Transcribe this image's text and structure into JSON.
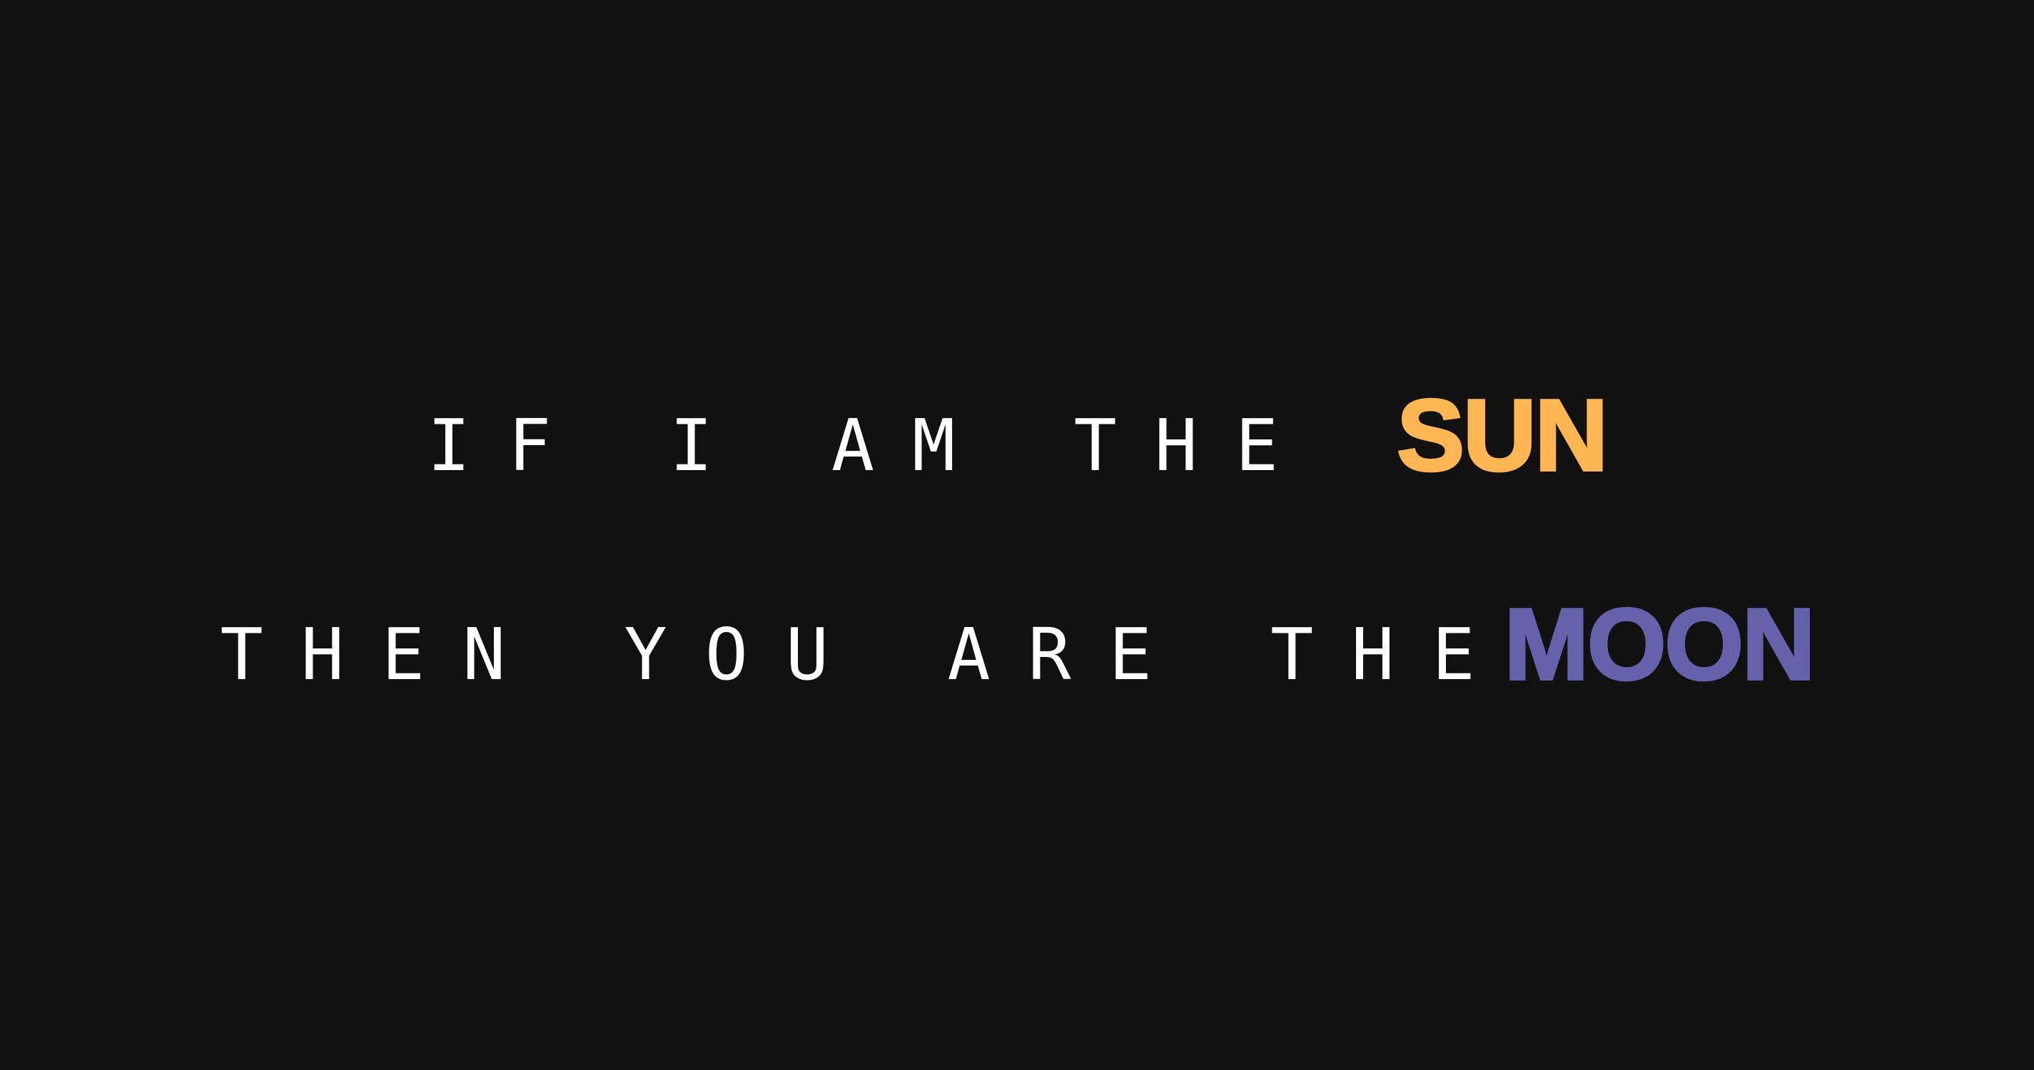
{
  "line1": {
    "lead": "IF I AM THE",
    "highlight": "SUN"
  },
  "line2": {
    "lead": "THEN YOU ARE THE",
    "highlight": "MOON"
  },
  "colors": {
    "background": "#111111",
    "text": "#ffffff",
    "sun": "#FFB653",
    "moon": "#6362AA"
  }
}
